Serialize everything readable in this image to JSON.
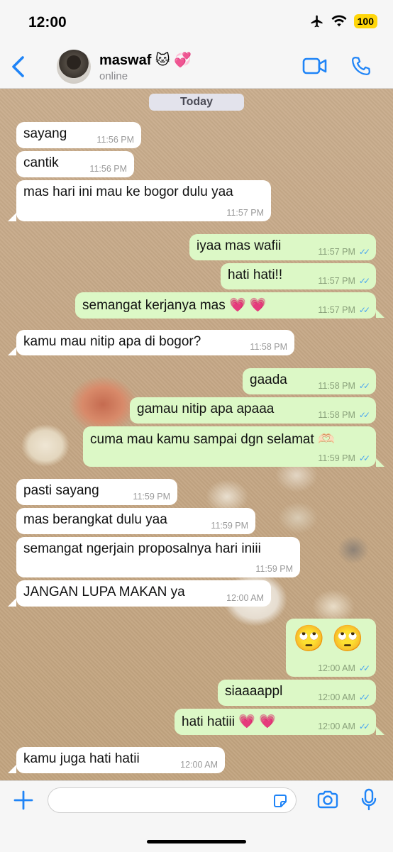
{
  "status_bar": {
    "time": "12:00",
    "battery": "100"
  },
  "header": {
    "contact_name": "maswaf 🐱 💞",
    "contact_status": "online"
  },
  "chat": {
    "date_chip": "Today",
    "messages": [
      {
        "dir": "in",
        "text": "sayang",
        "time": "11:56 PM"
      },
      {
        "dir": "in",
        "text": "cantik",
        "time": "11:56 PM"
      },
      {
        "dir": "in",
        "text": "mas hari ini mau ke bogor dulu yaa",
        "time": "11:57 PM"
      },
      {
        "dir": "out",
        "text": "iyaa mas wafii",
        "time": "11:57 PM"
      },
      {
        "dir": "out",
        "text": "hati hati!!",
        "time": "11:57 PM"
      },
      {
        "dir": "out",
        "text": "semangat kerjanya mas 💗 💗",
        "time": "11:57 PM"
      },
      {
        "dir": "in",
        "text": "kamu mau nitip apa di bogor?",
        "time": "11:58 PM"
      },
      {
        "dir": "out",
        "text": "gaada",
        "time": "11:58 PM"
      },
      {
        "dir": "out",
        "text": "gamau nitip apa apaaa",
        "time": "11:58 PM"
      },
      {
        "dir": "out",
        "text": "cuma mau kamu sampai dgn selamat 🫶🏻",
        "time": "11:59 PM"
      },
      {
        "dir": "in",
        "text": "pasti sayang",
        "time": "11:59 PM"
      },
      {
        "dir": "in",
        "text": "mas berangkat dulu yaa",
        "time": "11:59 PM"
      },
      {
        "dir": "in",
        "text": "semangat ngerjain proposalnya hari iniii",
        "time": "11:59 PM"
      },
      {
        "dir": "in",
        "text": "JANGAN LUPA MAKAN ya",
        "time": "12:00 AM"
      },
      {
        "dir": "out",
        "text": "🙄 🙄",
        "time": "12:00 AM"
      },
      {
        "dir": "out",
        "text": "siaaaappl",
        "time": "12:00 AM"
      },
      {
        "dir": "out",
        "text": "hati hatiii 💗 💗",
        "time": "12:00 AM"
      },
      {
        "dir": "in",
        "text": "kamu juga hati hatii",
        "time": "12:00 AM"
      }
    ]
  },
  "input_bar": {
    "placeholder": ""
  },
  "colors": {
    "accent": "#1f84f7",
    "outgoing": "#dcf8c6",
    "incoming": "#ffffff",
    "read_ticks": "#4ba6f0"
  },
  "icons": [
    "airplane-icon",
    "wifi-icon",
    "chevron-left-icon",
    "video-icon",
    "phone-icon",
    "plus-icon",
    "sticker-icon",
    "camera-icon",
    "mic-icon"
  ]
}
